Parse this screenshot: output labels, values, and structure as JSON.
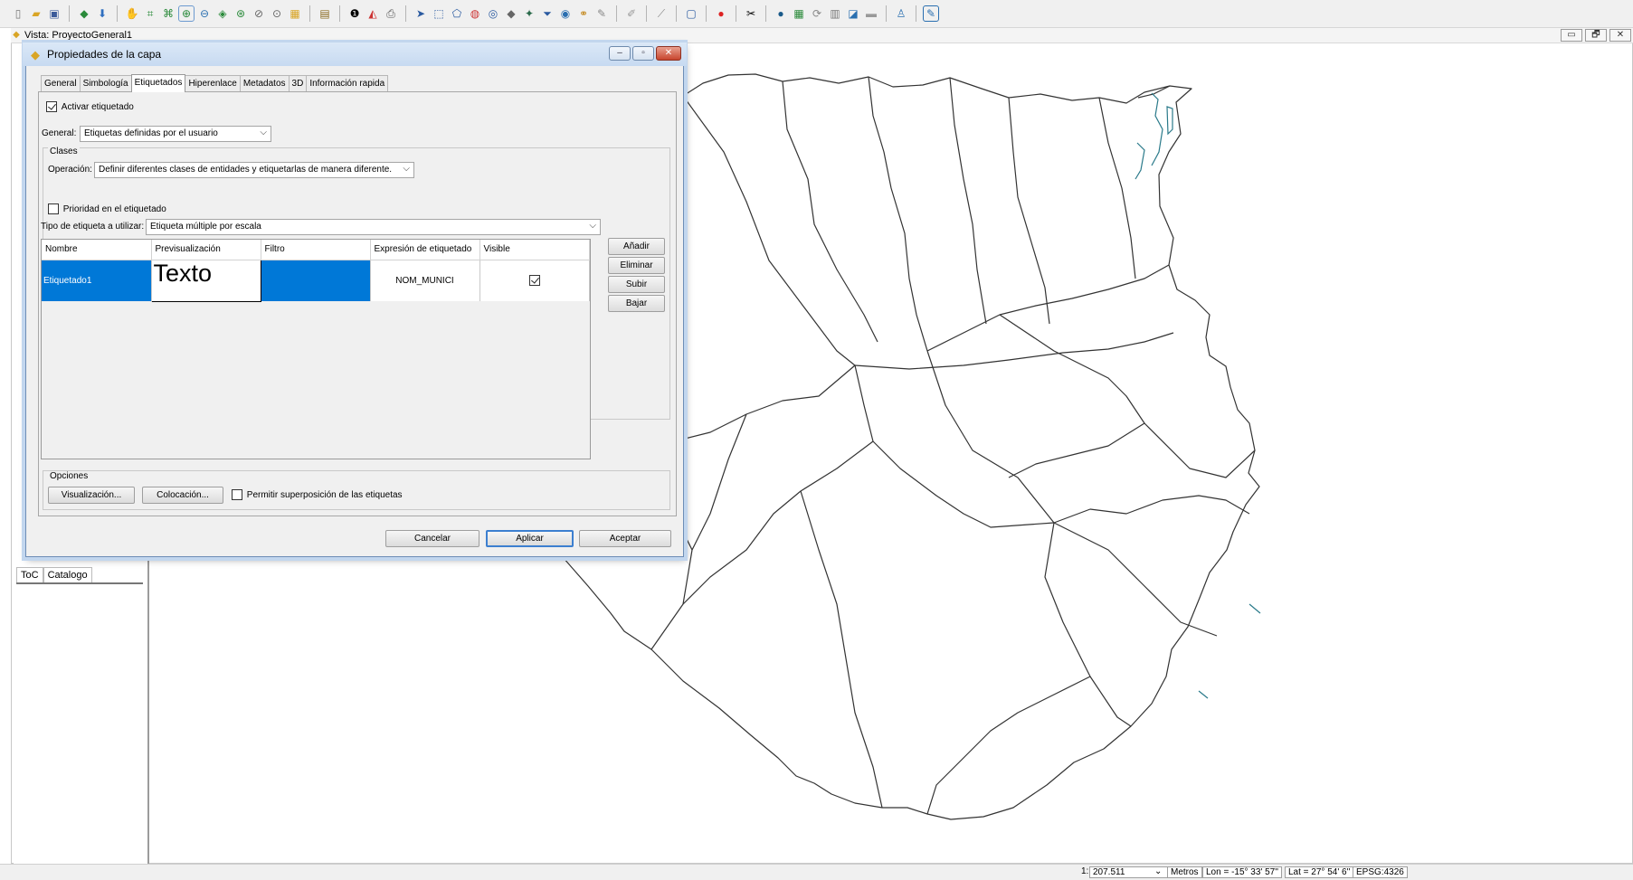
{
  "toolbar": {
    "icons": [
      "new-document",
      "open-folder",
      "save-disk",
      "add-layer",
      "export",
      "pan-hand",
      "full-extent",
      "zoom-extent",
      "zoom-in",
      "zoom-out",
      "zoom-layer",
      "zoom-select",
      "zoom-prev",
      "zoom-next",
      "layer-props",
      "table",
      "info",
      "measure",
      "print",
      "select-arrow",
      "select-rect",
      "select-polygon",
      "select-circle",
      "select-point",
      "edit-vertex",
      "edit-node",
      "filter-funnel",
      "globe",
      "link",
      "clear",
      "cad",
      "info-red",
      "tools",
      "globe-dark",
      "grid",
      "refresh",
      "db",
      "color",
      "window",
      "user",
      "edit"
    ]
  },
  "view": {
    "title": "Vista: ProyectoGeneral1",
    "controls": [
      "▭",
      "🗗",
      "✕"
    ]
  },
  "toc": {
    "tabs": [
      "ToC",
      "Catalogo"
    ]
  },
  "dialog": {
    "title": "Propiedades de la capa",
    "tabs": [
      "General",
      "Simbología",
      "Etiquetados",
      "Hiperenlace",
      "Metadatos",
      "3D",
      "Información rapida"
    ],
    "active_tab": "Etiquetados",
    "activate_label": "Activar etiquetado",
    "activate_checked": true,
    "general_label": "General:",
    "general_value": "Etiquetas definidas por el usuario",
    "classes_title": "Clases",
    "operation_label": "Operación:",
    "operation_value": "Definir diferentes clases de entidades y etiquetarlas de manera diferente.",
    "priority_label": "Prioridad en el etiquetado",
    "priority_checked": false,
    "label_type_label": "Tipo de etiqueta a utilizar:",
    "label_type_value": "Etiqueta múltiple por escala",
    "columns": [
      "Nombre",
      "Previsualización",
      "Filtro",
      "Expresión de etiquetado",
      "Visible"
    ],
    "rows": [
      {
        "name": "Etiquetado1",
        "preview": "Texto",
        "filter": "",
        "expression": "NOM_MUNICI",
        "visible": true
      }
    ],
    "side_buttons": [
      "Añadir",
      "Eliminar",
      "Subir",
      "Bajar"
    ],
    "options_title": "Opciones",
    "visualization_button": "Visualización...",
    "placement_button": "Colocación...",
    "overlap_label": "Permitir superposición de las etiquetas",
    "overlap_checked": false,
    "cancel_button": "Cancelar",
    "apply_button": "Aplicar",
    "accept_button": "Aceptar"
  },
  "status": {
    "scale_prefix": "1:",
    "scale_value": "207.511",
    "units": "Metros",
    "lon": "Lon = -15° 33' 57''",
    "lat": "Lat = 27° 54' 6''",
    "epsg": "EPSG:4326"
  },
  "colors": {
    "selection": "#0078d7",
    "map_line": "#333333",
    "coast_accent": "#2a7a8a"
  }
}
